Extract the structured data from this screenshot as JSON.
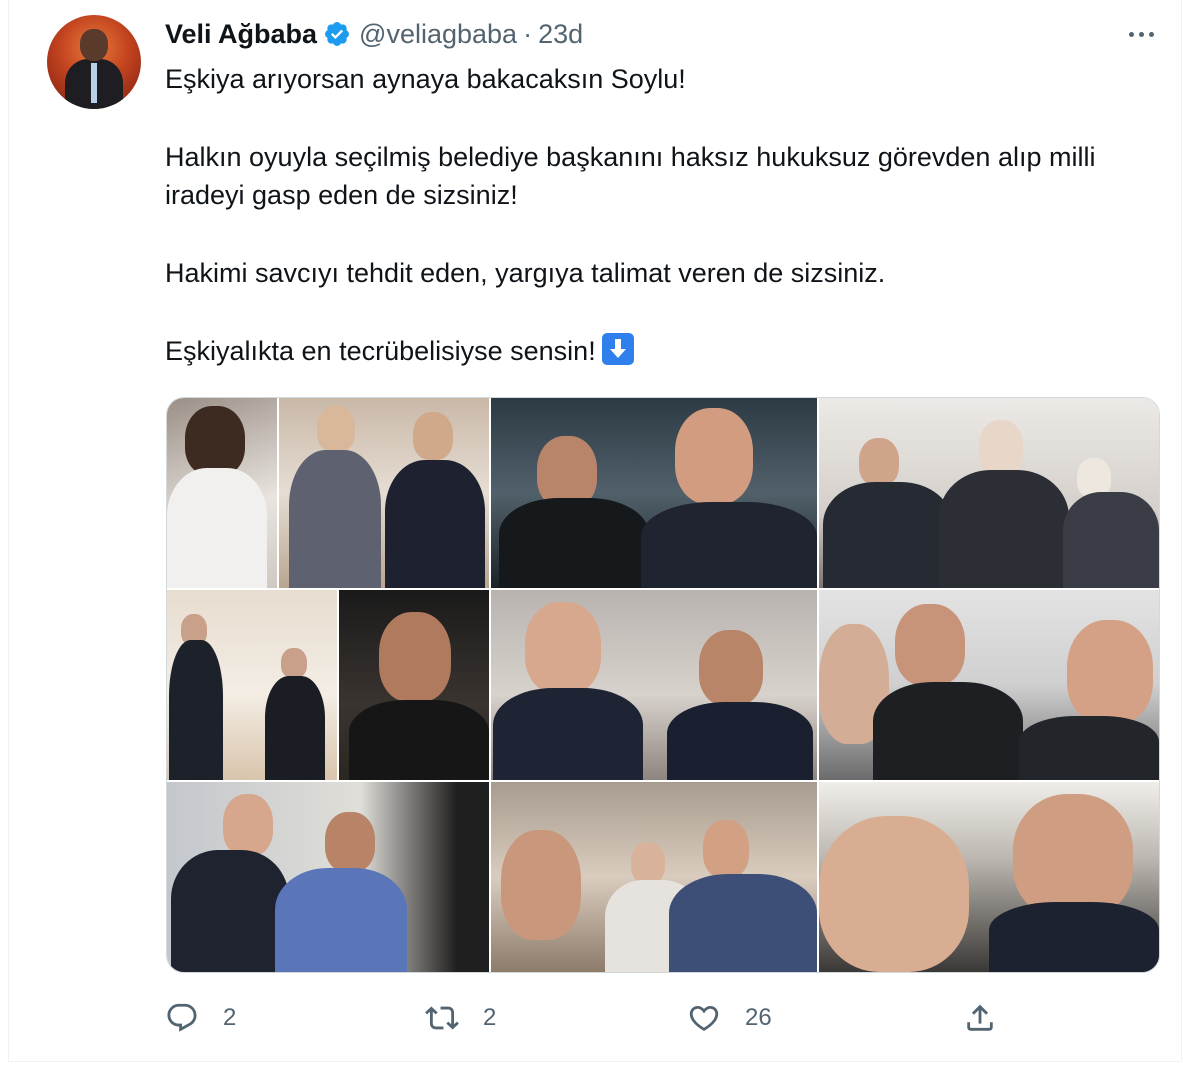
{
  "tweet": {
    "author_name": "Veli Ağbaba",
    "author_handle": "@veliagbaba",
    "separator": "·",
    "time": "23d",
    "paragraphs": [
      "Eşkiya arıyorsan aynaya bakacaksın Soylu!",
      "Halkın oyuyla seçilmiş belediye başkanını haksız hukuksuz görevden alıp milli iradeyi gasp eden de sizsiniz!",
      "Hakimi savcıyı tehdit eden, yargıya talimat veren de sizsiniz.",
      "Eşkiyalıkta en tecrübelisiyse sensin!"
    ],
    "emoji": "arrow-down-emoji",
    "media": {
      "type": "photo-collage",
      "rows": 3,
      "columns": 3
    }
  },
  "actions": {
    "reply_count": "2",
    "retweet_count": "2",
    "like_count": "26"
  },
  "colors": {
    "text": "#0f1419",
    "secondary": "#536471",
    "verified": "#1d9bf0",
    "border": "#cfd9de"
  },
  "icons": [
    "verified-badge-icon",
    "more-icon",
    "reply-icon",
    "retweet-icon",
    "like-icon",
    "share-icon"
  ]
}
